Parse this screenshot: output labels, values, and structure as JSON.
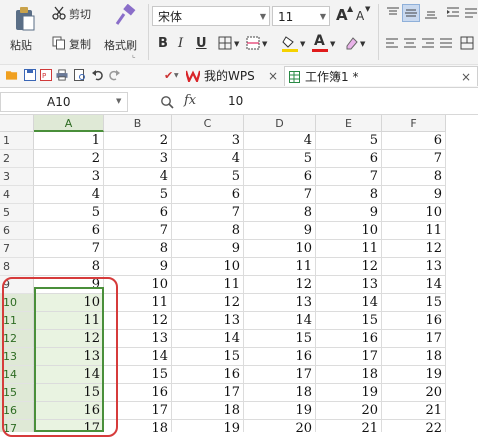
{
  "ribbon": {
    "cut_label": "剪切",
    "paste_label": "粘贴",
    "copy_label": "复制",
    "format_painter_label": "格式刷",
    "font_name": "宋体",
    "font_size": "11",
    "grow_font": "A",
    "shrink_font": "A",
    "bold": "B",
    "italic": "I",
    "underline": "U",
    "font_color_letter": "A"
  },
  "tabs": {
    "wps_tab_label": "我的WPS",
    "workbook_tab_label": "工作簿1 *",
    "close_glyph": "×"
  },
  "formula_bar": {
    "name_box": "A10",
    "fx_label": "fx",
    "value": "10"
  },
  "sheet": {
    "columns": [
      "A",
      "B",
      "C",
      "D",
      "E",
      "F"
    ],
    "row_labels": [
      "1",
      "2",
      "3",
      "4",
      "5",
      "6",
      "7",
      "8",
      "9",
      "10",
      "11",
      "12",
      "13",
      "14",
      "15",
      "16",
      "17"
    ],
    "rows": [
      [
        1,
        2,
        3,
        4,
        5,
        6
      ],
      [
        2,
        3,
        4,
        5,
        6,
        7
      ],
      [
        3,
        4,
        5,
        6,
        7,
        8
      ],
      [
        4,
        5,
        6,
        7,
        8,
        9
      ],
      [
        5,
        6,
        7,
        8,
        9,
        10
      ],
      [
        6,
        7,
        8,
        9,
        10,
        11
      ],
      [
        7,
        8,
        9,
        10,
        11,
        12
      ],
      [
        8,
        9,
        10,
        11,
        12,
        13
      ],
      [
        9,
        10,
        11,
        12,
        13,
        14
      ],
      [
        10,
        11,
        12,
        13,
        14,
        15
      ],
      [
        11,
        12,
        13,
        14,
        15,
        16
      ],
      [
        12,
        13,
        14,
        15,
        16,
        17
      ],
      [
        13,
        14,
        15,
        16,
        17,
        18
      ],
      [
        14,
        15,
        16,
        17,
        18,
        19
      ],
      [
        15,
        16,
        17,
        18,
        19,
        20
      ],
      [
        16,
        17,
        18,
        19,
        20,
        21
      ],
      [
        17,
        18,
        19,
        20,
        21,
        22
      ]
    ],
    "highlight_color": "#e9f3e1",
    "selection_color": "#4a8f3a",
    "annotation_color": "#d63b3b"
  }
}
